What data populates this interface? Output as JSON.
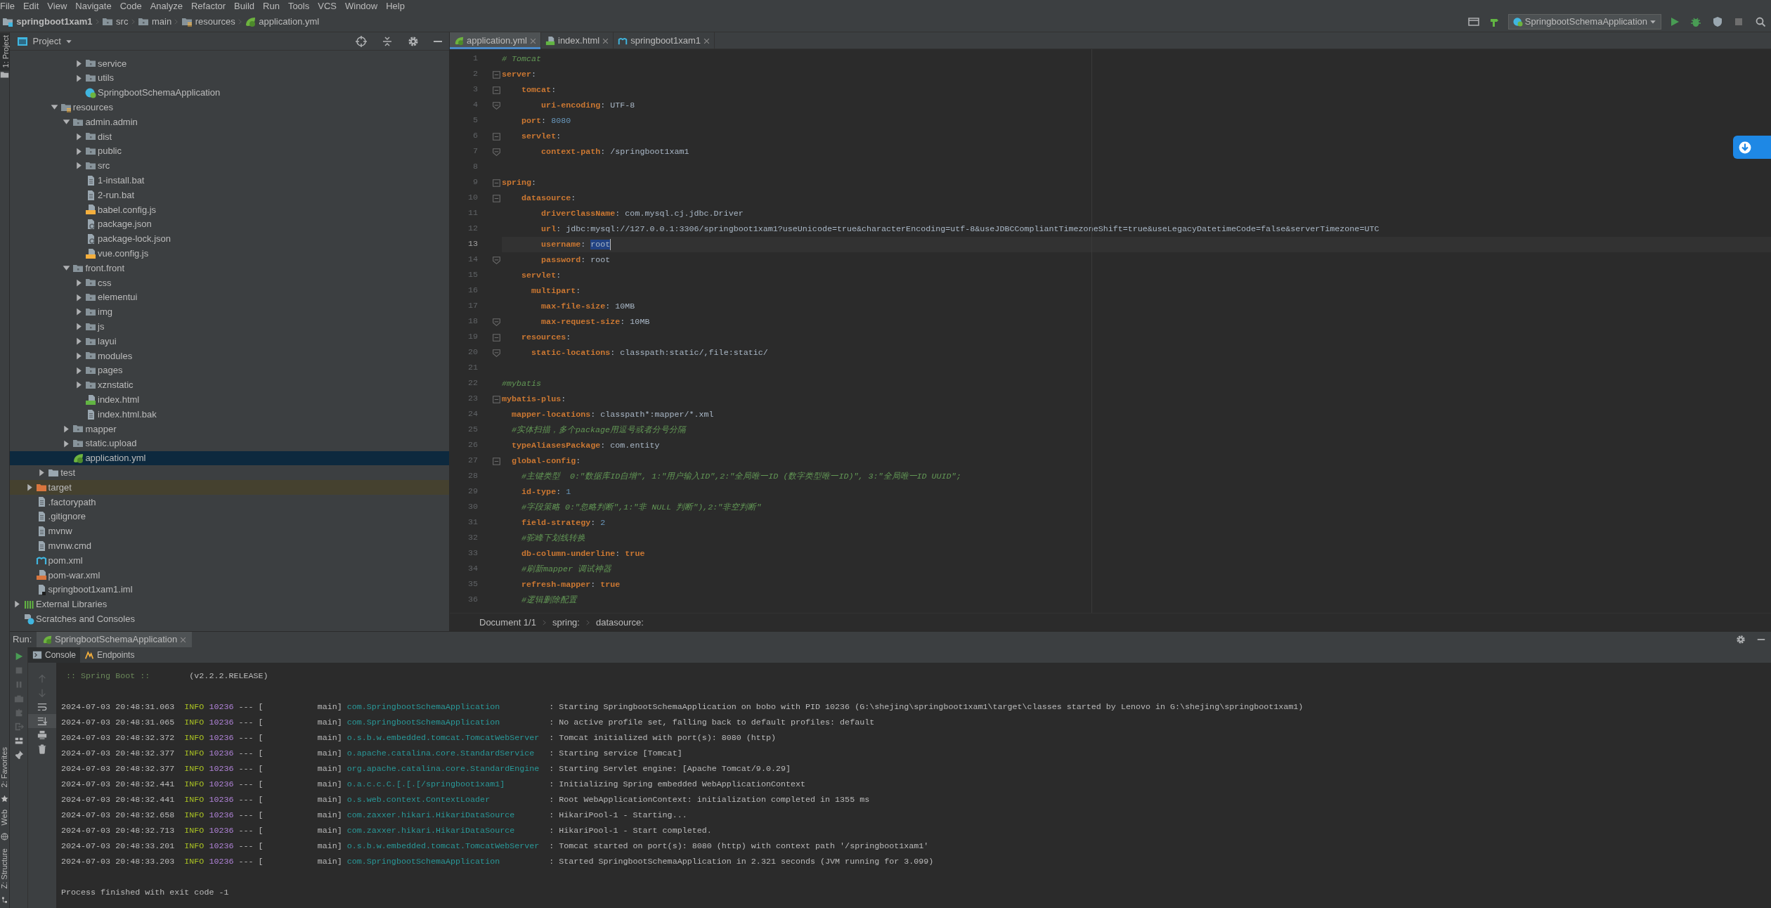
{
  "menu": [
    "File",
    "Edit",
    "View",
    "Navigate",
    "Code",
    "Analyze",
    "Refactor",
    "Build",
    "Run",
    "Tools",
    "VCS",
    "Window",
    "Help"
  ],
  "nav_path": [
    {
      "label": "springboot1xam1",
      "kind": "project"
    },
    {
      "label": "src",
      "kind": "folder"
    },
    {
      "label": "main",
      "kind": "folder"
    },
    {
      "label": "resources",
      "kind": "resources"
    },
    {
      "label": "application.yml",
      "kind": "yml"
    }
  ],
  "toolbar": {
    "run_config": "SpringbootSchemaApplication"
  },
  "tool_tabs_top": [
    {
      "label": "1: Project",
      "selected": true
    }
  ],
  "tool_tabs_bottom": [
    {
      "label": "2: Favorites",
      "kind": "favorites"
    },
    {
      "label": "Web",
      "kind": "web"
    },
    {
      "label": "Z: Structure",
      "kind": "structure"
    }
  ],
  "project": {
    "title": "Project",
    "tree": [
      {
        "children": [
          {
            "children": [
              {
                "children": [
                  {
                    "children": [
                      {
                        "children": [
                          {
                            "label": "service",
                            "kind": "folder",
                            "expanded": false,
                            "selected": false
                          },
                          {
                            "label": "utils",
                            "kind": "folder",
                            "expanded": false,
                            "selected": false
                          },
                          {
                            "label": "SpringbootSchemaApplication",
                            "kind": "app",
                            "selected": false
                          }
                        ]
                      }
                    ]
                  },
                  {
                    "label": "resources",
                    "kind": "resources",
                    "expanded": true,
                    "selected": false,
                    "children": [
                      {
                        "label": "admin.admin",
                        "kind": "folder",
                        "expanded": true,
                        "selected": false,
                        "children": [
                          {
                            "label": "dist",
                            "kind": "folder",
                            "expanded": false,
                            "selected": false
                          },
                          {
                            "label": "public",
                            "kind": "folder",
                            "expanded": false,
                            "selected": false
                          },
                          {
                            "label": "src",
                            "kind": "folder",
                            "expanded": false,
                            "selected": false
                          },
                          {
                            "label": "1-install.bat",
                            "kind": "text",
                            "selected": false
                          },
                          {
                            "label": "2-run.bat",
                            "kind": "text",
                            "selected": false
                          },
                          {
                            "label": "babel.config.js",
                            "kind": "js",
                            "selected": false
                          },
                          {
                            "label": "package.json",
                            "kind": "json",
                            "selected": false
                          },
                          {
                            "label": "package-lock.json",
                            "kind": "json",
                            "selected": false
                          },
                          {
                            "label": "vue.config.js",
                            "kind": "js",
                            "selected": false
                          }
                        ]
                      },
                      {
                        "label": "front.front",
                        "kind": "folder",
                        "expanded": true,
                        "selected": false,
                        "children": [
                          {
                            "label": "css",
                            "kind": "folder",
                            "expanded": false,
                            "selected": false
                          },
                          {
                            "label": "elementui",
                            "kind": "folder",
                            "expanded": false,
                            "selected": false
                          },
                          {
                            "label": "img",
                            "kind": "folder",
                            "expanded": false,
                            "selected": false
                          },
                          {
                            "label": "js",
                            "kind": "folder",
                            "expanded": false,
                            "selected": false
                          },
                          {
                            "label": "layui",
                            "kind": "folder",
                            "expanded": false,
                            "selected": false
                          },
                          {
                            "label": "modules",
                            "kind": "folder",
                            "expanded": false,
                            "selected": false
                          },
                          {
                            "label": "pages",
                            "kind": "folder",
                            "expanded": false,
                            "selected": false
                          },
                          {
                            "label": "xznstatic",
                            "kind": "folder",
                            "expanded": false,
                            "selected": false
                          },
                          {
                            "label": "index.html",
                            "kind": "html",
                            "selected": false
                          },
                          {
                            "label": "index.html.bak",
                            "kind": "text",
                            "selected": false
                          }
                        ]
                      },
                      {
                        "label": "mapper",
                        "kind": "folder",
                        "expanded": false,
                        "selected": false
                      },
                      {
                        "label": "static.upload",
                        "kind": "folder",
                        "expanded": false,
                        "selected": false
                      },
                      {
                        "label": "application.yml",
                        "kind": "yml",
                        "selected": true
                      }
                    ]
                  }
                ]
              },
              {
                "label": "test",
                "kind": "plainfolder",
                "expanded": false,
                "selected": false
              }
            ]
          },
          {
            "label": "target",
            "kind": "excluded",
            "expanded": false,
            "selected": false
          },
          {
            "label": ".factorypath",
            "kind": "text",
            "selected": false
          },
          {
            "label": ".gitignore",
            "kind": "text",
            "selected": false
          },
          {
            "label": "mvnw",
            "kind": "text",
            "selected": false
          },
          {
            "label": "mvnw.cmd",
            "kind": "text",
            "selected": false
          },
          {
            "label": "pom.xml",
            "kind": "maven",
            "selected": false
          },
          {
            "label": "pom-war.xml",
            "kind": "xml",
            "selected": false
          },
          {
            "label": "springboot1xam1.iml",
            "kind": "iml",
            "selected": false
          }
        ]
      },
      {
        "label": "External Libraries",
        "kind": "libraries",
        "expanded": false,
        "selected": false
      },
      {
        "label": "Scratches and Consoles",
        "kind": "scratches",
        "selected": false
      }
    ]
  },
  "editor": {
    "tabs": [
      {
        "label": "application.yml",
        "kind": "yml",
        "selected": true
      },
      {
        "label": "index.html",
        "kind": "html",
        "selected": false
      },
      {
        "label": "springboot1xam1",
        "kind": "maven",
        "selected": false
      }
    ],
    "lines": [
      {
        "number": "1",
        "fold_start": false,
        "fold_end": false,
        "current": false,
        "parts": [
          {
            "kind": "comment",
            "text": "# Tomcat"
          }
        ]
      },
      {
        "number": "2",
        "fold_start": true,
        "fold_end": false,
        "current": false,
        "parts": [
          {
            "kind": "key",
            "text": "server"
          },
          {
            "kind": "plain",
            "text": ":"
          }
        ]
      },
      {
        "number": "3",
        "fold_start": true,
        "fold_end": false,
        "current": false,
        "parts": [
          {
            "kind": "key",
            "text": "    tomcat"
          },
          {
            "kind": "plain",
            "text": ":"
          }
        ]
      },
      {
        "number": "4",
        "fold_start": false,
        "fold_end": true,
        "current": false,
        "parts": [
          {
            "kind": "key",
            "text": "        uri-encoding"
          },
          {
            "kind": "plain",
            "text": ": UTF-8"
          }
        ]
      },
      {
        "number": "5",
        "fold_start": false,
        "fold_end": false,
        "current": false,
        "parts": [
          {
            "kind": "key",
            "text": "    port"
          },
          {
            "kind": "plain",
            "text": ": "
          },
          {
            "kind": "number",
            "text": "8080"
          }
        ]
      },
      {
        "number": "6",
        "fold_start": true,
        "fold_end": false,
        "current": false,
        "parts": [
          {
            "kind": "key",
            "text": "    servlet"
          },
          {
            "kind": "plain",
            "text": ":"
          }
        ]
      },
      {
        "number": "7",
        "fold_start": false,
        "fold_end": true,
        "current": false,
        "parts": [
          {
            "kind": "key",
            "text": "        context-path"
          },
          {
            "kind": "plain",
            "text": ": /springboot1xam1"
          }
        ]
      },
      {
        "number": "8",
        "fold_start": false,
        "fold_end": false,
        "current": false
      },
      {
        "number": "9",
        "fold_start": true,
        "fold_end": false,
        "current": false,
        "parts": [
          {
            "kind": "key",
            "text": "spring"
          },
          {
            "kind": "plain",
            "text": ":"
          }
        ]
      },
      {
        "number": "10",
        "fold_start": true,
        "fold_end": false,
        "current": false,
        "parts": [
          {
            "kind": "key",
            "text": "    datasource"
          },
          {
            "kind": "plain",
            "text": ":"
          }
        ]
      },
      {
        "number": "11",
        "fold_start": false,
        "fold_end": false,
        "current": false,
        "parts": [
          {
            "kind": "key",
            "text": "        driverClassName"
          },
          {
            "kind": "plain",
            "text": ": com.mysql.cj.jdbc.Driver"
          }
        ]
      },
      {
        "number": "12",
        "fold_start": false,
        "fold_end": false,
        "current": false,
        "parts": [
          {
            "kind": "key",
            "text": "        url"
          },
          {
            "kind": "plain",
            "text": ": jdbc:mysql://127.0.0.1:3306/springboot1xam1?useUnicode=true&characterEncoding=utf-8&useJDBCCompliantTimezoneShift=true&useLegacyDatetimeCode=false&serverTimezone=UTC"
          }
        ]
      },
      {
        "number": "13",
        "fold_start": false,
        "fold_end": false,
        "current": true,
        "parts": [
          {
            "kind": "key",
            "text": "        username"
          },
          {
            "kind": "plain",
            "text": ": "
          },
          {
            "kind": "selection",
            "text": "root"
          }
        ]
      },
      {
        "number": "14",
        "fold_start": false,
        "fold_end": true,
        "current": false,
        "parts": [
          {
            "kind": "key",
            "text": "        password"
          },
          {
            "kind": "plain",
            "text": ": root"
          }
        ]
      },
      {
        "number": "15",
        "fold_start": false,
        "fold_end": false,
        "current": false,
        "parts": [
          {
            "kind": "key",
            "text": "    servlet"
          },
          {
            "kind": "plain",
            "text": ":"
          }
        ]
      },
      {
        "number": "16",
        "fold_start": false,
        "fold_end": false,
        "current": false,
        "parts": [
          {
            "kind": "key",
            "text": "      multipart"
          },
          {
            "kind": "plain",
            "text": ":"
          }
        ]
      },
      {
        "number": "17",
        "fold_start": false,
        "fold_end": false,
        "current": false,
        "parts": [
          {
            "kind": "key",
            "text": "        max-file-size"
          },
          {
            "kind": "plain",
            "text": ": 10MB"
          }
        ]
      },
      {
        "number": "18",
        "fold_start": false,
        "fold_end": true,
        "current": false,
        "parts": [
          {
            "kind": "key",
            "text": "        max-request-size"
          },
          {
            "kind": "plain",
            "text": ": 10MB"
          }
        ]
      },
      {
        "number": "19",
        "fold_start": true,
        "fold_end": false,
        "current": false,
        "parts": [
          {
            "kind": "key",
            "text": "    resources"
          },
          {
            "kind": "plain",
            "text": ":"
          }
        ]
      },
      {
        "number": "20",
        "fold_start": false,
        "fold_end": true,
        "current": false,
        "parts": [
          {
            "kind": "key",
            "text": "      static-locations"
          },
          {
            "kind": "plain",
            "text": ": classpath:static/,file:static/"
          }
        ]
      },
      {
        "number": "21",
        "fold_start": false,
        "fold_end": false,
        "current": false
      },
      {
        "number": "22",
        "fold_start": false,
        "fold_end": false,
        "current": false,
        "parts": [
          {
            "kind": "comment",
            "text": "#mybatis"
          }
        ]
      },
      {
        "number": "23",
        "fold_start": true,
        "fold_end": false,
        "current": false,
        "parts": [
          {
            "kind": "key",
            "text": "mybatis-plus"
          },
          {
            "kind": "plain",
            "text": ":"
          }
        ]
      },
      {
        "number": "24",
        "fold_start": false,
        "fold_end": false,
        "current": false,
        "parts": [
          {
            "kind": "key",
            "text": "  mapper-locations"
          },
          {
            "kind": "plain",
            "text": ": classpath*:mapper/*.xml"
          }
        ]
      },
      {
        "number": "25",
        "fold_start": false,
        "fold_end": false,
        "current": false,
        "parts": [
          {
            "kind": "comment",
            "text": "  #实体扫描，多个package用逗号或者分号分隔"
          }
        ]
      },
      {
        "number": "26",
        "fold_start": false,
        "fold_end": false,
        "current": false,
        "parts": [
          {
            "kind": "key",
            "text": "  typeAliasesPackage"
          },
          {
            "kind": "plain",
            "text": ": com.entity"
          }
        ]
      },
      {
        "number": "27",
        "fold_start": true,
        "fold_end": false,
        "current": false,
        "parts": [
          {
            "kind": "key",
            "text": "  global-config"
          },
          {
            "kind": "plain",
            "text": ":"
          }
        ]
      },
      {
        "number": "28",
        "fold_start": false,
        "fold_end": false,
        "current": false,
        "parts": [
          {
            "kind": "comment",
            "text": "    #主键类型  0:\"数据库ID自增\", 1:\"用户输入ID\",2:\"全局唯一ID (数字类型唯一ID)\", 3:\"全局唯一ID UUID\";"
          }
        ]
      },
      {
        "number": "29",
        "fold_start": false,
        "fold_end": false,
        "current": false,
        "parts": [
          {
            "kind": "key",
            "text": "    id-type"
          },
          {
            "kind": "plain",
            "text": ": "
          },
          {
            "kind": "number",
            "text": "1"
          }
        ]
      },
      {
        "number": "30",
        "fold_start": false,
        "fold_end": false,
        "current": false,
        "parts": [
          {
            "kind": "comment",
            "text": "    #字段策略 0:\"忽略判断\",1:\"非 NULL 判断\"),2:\"非空判断\""
          }
        ]
      },
      {
        "number": "31",
        "fold_start": false,
        "fold_end": false,
        "current": false,
        "parts": [
          {
            "kind": "key",
            "text": "    field-strategy"
          },
          {
            "kind": "plain",
            "text": ": "
          },
          {
            "kind": "number",
            "text": "2"
          }
        ]
      },
      {
        "number": "32",
        "fold_start": false,
        "fold_end": false,
        "current": false,
        "parts": [
          {
            "kind": "comment",
            "text": "    #驼峰下划线转换"
          }
        ]
      },
      {
        "number": "33",
        "fold_start": false,
        "fold_end": false,
        "current": false,
        "parts": [
          {
            "kind": "key",
            "text": "    db-column-underline"
          },
          {
            "kind": "plain",
            "text": ": "
          },
          {
            "kind": "bool",
            "text": "true"
          }
        ]
      },
      {
        "number": "34",
        "fold_start": false,
        "fold_end": false,
        "current": false,
        "parts": [
          {
            "kind": "comment",
            "text": "    #刷新mapper 调试神器"
          }
        ]
      },
      {
        "number": "35",
        "fold_start": false,
        "fold_end": false,
        "current": false,
        "parts": [
          {
            "kind": "key",
            "text": "    refresh-mapper"
          },
          {
            "kind": "plain",
            "text": ": "
          },
          {
            "kind": "bool",
            "text": "true"
          }
        ]
      },
      {
        "number": "36",
        "fold_start": false,
        "fold_end": false,
        "current": false,
        "parts": [
          {
            "kind": "comment",
            "text": "    #逻辑删除配置"
          }
        ]
      }
    ],
    "breadcrumb": [
      "Document 1/1",
      "spring:",
      "datasource:"
    ]
  },
  "run": {
    "label": "Run:",
    "tabs": [
      {
        "label": "SpringbootSchemaApplication",
        "selected": true
      }
    ],
    "subtabs": [
      {
        "label": "Console",
        "kind": "console",
        "selected": true
      },
      {
        "label": "Endpoints",
        "kind": "endpoints",
        "selected": false
      }
    ],
    "banner": ":: Spring Boot ::",
    "version": "(v2.2.2.RELEASE)",
    "log": [
      {
        "time": "2024-07-03 20:48:31.063",
        "level": "INFO",
        "pid": "10236",
        "dashes": "---",
        "thread": "[           main]",
        "logger": "com.SpringbootSchemaApplication",
        "message": ": Starting SpringbootSchemaApplication on bobo with PID 10236 (G:\\shejing\\springboot1xam1\\target\\classes started by Lenovo in G:\\shejing\\springboot1xam1)"
      },
      {
        "time": "2024-07-03 20:48:31.065",
        "level": "INFO",
        "pid": "10236",
        "dashes": "---",
        "thread": "[           main]",
        "logger": "com.SpringbootSchemaApplication",
        "message": ": No active profile set, falling back to default profiles: default"
      },
      {
        "time": "2024-07-03 20:48:32.372",
        "level": "INFO",
        "pid": "10236",
        "dashes": "---",
        "thread": "[           main]",
        "logger": "o.s.b.w.embedded.tomcat.TomcatWebServer",
        "message": ": Tomcat initialized with port(s): 8080 (http)"
      },
      {
        "time": "2024-07-03 20:48:32.377",
        "level": "INFO",
        "pid": "10236",
        "dashes": "---",
        "thread": "[           main]",
        "logger": "o.apache.catalina.core.StandardService",
        "message": ": Starting service [Tomcat]"
      },
      {
        "time": "2024-07-03 20:48:32.377",
        "level": "INFO",
        "pid": "10236",
        "dashes": "---",
        "thread": "[           main]",
        "logger": "org.apache.catalina.core.StandardEngine",
        "message": ": Starting Servlet engine: [Apache Tomcat/9.0.29]"
      },
      {
        "time": "2024-07-03 20:48:32.441",
        "level": "INFO",
        "pid": "10236",
        "dashes": "---",
        "thread": "[           main]",
        "logger": "o.a.c.c.C.[.[.[/springboot1xam1]",
        "message": ": Initializing Spring embedded WebApplicationContext"
      },
      {
        "time": "2024-07-03 20:48:32.441",
        "level": "INFO",
        "pid": "10236",
        "dashes": "---",
        "thread": "[           main]",
        "logger": "o.s.web.context.ContextLoader",
        "message": ": Root WebApplicationContext: initialization completed in 1355 ms"
      },
      {
        "time": "2024-07-03 20:48:32.658",
        "level": "INFO",
        "pid": "10236",
        "dashes": "---",
        "thread": "[           main]",
        "logger": "com.zaxxer.hikari.HikariDataSource",
        "message": ": HikariPool-1 - Starting..."
      },
      {
        "time": "2024-07-03 20:48:32.713",
        "level": "INFO",
        "pid": "10236",
        "dashes": "---",
        "thread": "[           main]",
        "logger": "com.zaxxer.hikari.HikariDataSource",
        "message": ": HikariPool-1 - Start completed."
      },
      {
        "time": "2024-07-03 20:48:33.201",
        "level": "INFO",
        "pid": "10236",
        "dashes": "---",
        "thread": "[           main]",
        "logger": "o.s.b.w.embedded.tomcat.TomcatWebServer",
        "message": ": Tomcat started on port(s): 8080 (http) with context path '/springboot1xam1'"
      },
      {
        "time": "2024-07-03 20:48:33.203",
        "level": "INFO",
        "pid": "10236",
        "dashes": "---",
        "thread": "[           main]",
        "logger": "com.SpringbootSchemaApplication",
        "message": ": Started SpringbootSchemaApplication in 2.321 seconds (JVM running for 3.099)"
      }
    ],
    "footer": "Process finished with exit code -1"
  }
}
